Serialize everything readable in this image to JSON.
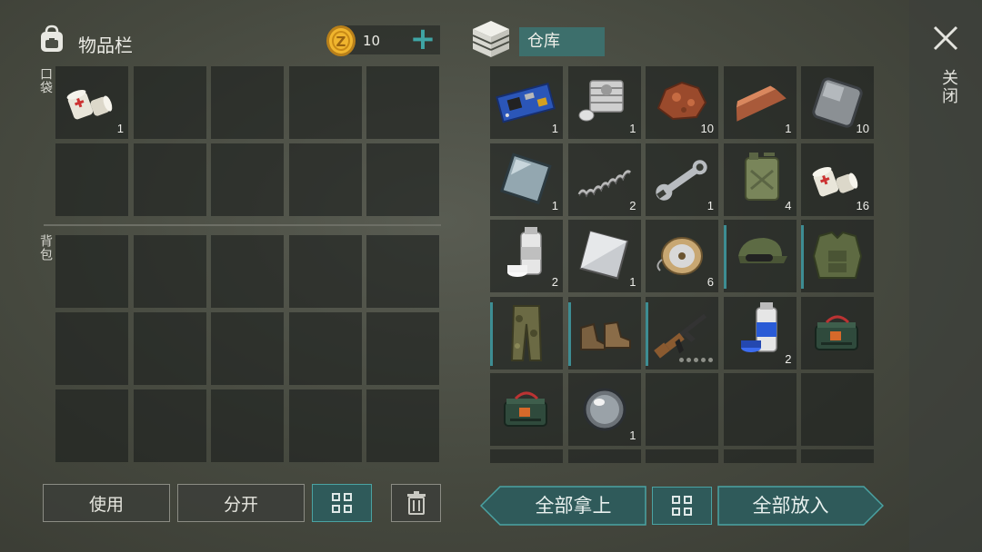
{
  "inventory": {
    "title": "物品栏",
    "pocket_label": "口袋",
    "backpack_label": "背包",
    "coins": "10",
    "add_symbol": "+",
    "pocket_items": [
      {
        "icon": "bandage-icon",
        "count": "1"
      }
    ]
  },
  "storage": {
    "title": "仓库",
    "close_label": "关闭",
    "items": [
      {
        "icon": "circuit-board-icon",
        "count": "1",
        "rarity": false
      },
      {
        "icon": "engine-block-icon",
        "count": "1",
        "rarity": false
      },
      {
        "icon": "copper-ore-icon",
        "count": "10",
        "rarity": false
      },
      {
        "icon": "copper-ingot-icon",
        "count": "1",
        "rarity": false
      },
      {
        "icon": "iron-plate-icon",
        "count": "10",
        "rarity": false
      },
      {
        "icon": "glass-plate-icon",
        "count": "1",
        "rarity": false
      },
      {
        "icon": "spring-icon",
        "count": "2",
        "rarity": false
      },
      {
        "icon": "wrench-icon",
        "count": "1",
        "rarity": false
      },
      {
        "icon": "jerrycan-icon",
        "count": "4",
        "rarity": false
      },
      {
        "icon": "bandage-icon",
        "count": "16",
        "rarity": false
      },
      {
        "icon": "white-paint-icon",
        "count": "2",
        "rarity": false
      },
      {
        "icon": "steel-sheet-icon",
        "count": "1",
        "rarity": false
      },
      {
        "icon": "wire-spool-icon",
        "count": "6",
        "rarity": false
      },
      {
        "icon": "military-cap-icon",
        "count": "",
        "rarity": true
      },
      {
        "icon": "body-armor-icon",
        "count": "",
        "rarity": true
      },
      {
        "icon": "camo-pants-icon",
        "count": "",
        "rarity": true
      },
      {
        "icon": "boots-icon",
        "count": "",
        "rarity": true
      },
      {
        "icon": "assault-rifle-icon",
        "count": "",
        "rarity": true
      },
      {
        "icon": "blue-paint-icon",
        "count": "2",
        "rarity": false
      },
      {
        "icon": "explosive-charge-icon",
        "count": "",
        "rarity": false
      },
      {
        "icon": "explosive-charge-icon",
        "count": "",
        "rarity": false
      },
      {
        "icon": "lens-icon",
        "count": "1",
        "rarity": false
      }
    ]
  },
  "actions": {
    "use": "使用",
    "split": "分开",
    "take_all": "全部拿上",
    "put_all": "全部放入"
  },
  "colors": {
    "accent": "#3d8d93",
    "panel": "#2f5a5a",
    "coin": "#e0a423"
  }
}
